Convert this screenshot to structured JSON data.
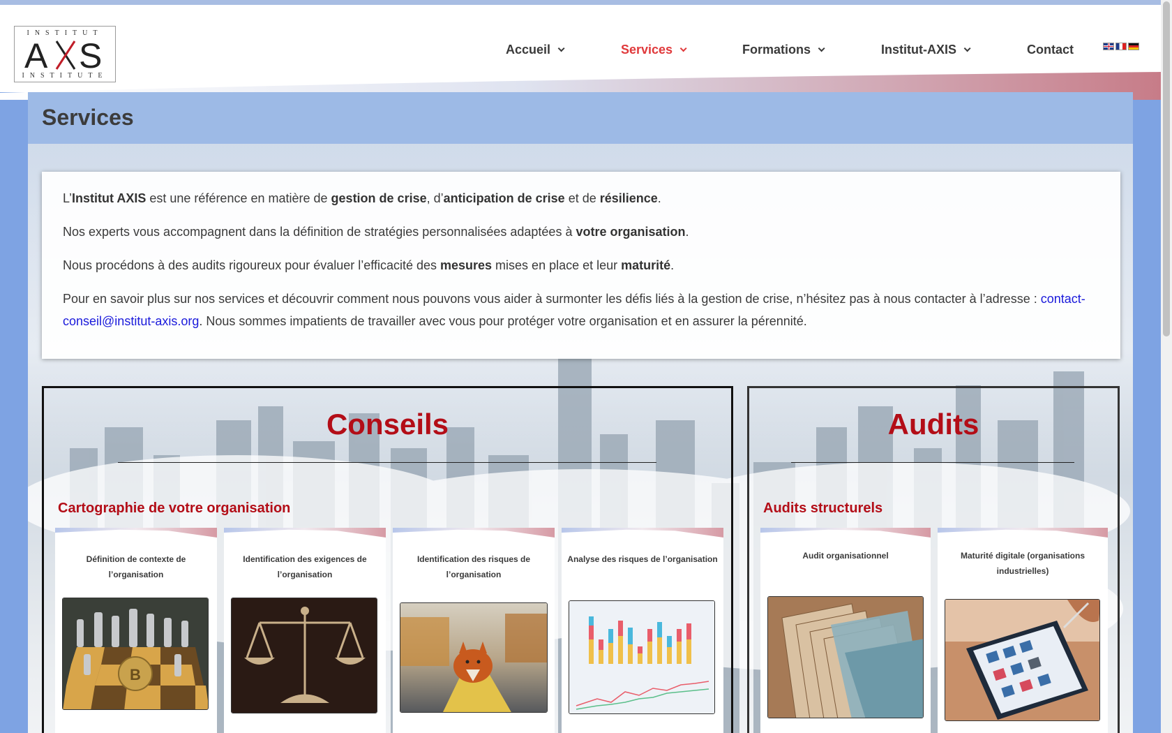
{
  "header": {
    "logo": {
      "top": "INSTITUT",
      "mid": "AXS",
      "bottom": "INSTITUTE"
    },
    "nav": [
      {
        "label": "Accueil",
        "has_dropdown": true,
        "active": false
      },
      {
        "label": "Services",
        "has_dropdown": true,
        "active": true
      },
      {
        "label": "Formations",
        "has_dropdown": true,
        "active": false
      },
      {
        "label": "Institut-AXIS",
        "has_dropdown": true,
        "active": false
      },
      {
        "label": "Contact",
        "has_dropdown": false,
        "active": false
      }
    ],
    "languages": [
      "en",
      "fr",
      "de"
    ],
    "active_color": "#e0393b"
  },
  "page": {
    "title": "Services"
  },
  "intro": {
    "p1": {
      "a": "L’",
      "b": "Institut AXIS",
      "c": " est une référence en matière de ",
      "d": "gestion de crise",
      "e": ", d’",
      "f": "anticipation de crise",
      "g": " et de ",
      "h": "résilience",
      "i": "."
    },
    "p2": {
      "a": "Nos experts vous accompagnent dans la définition de stratégies personnalisées adaptées à ",
      "b": "votre organisation",
      "c": "."
    },
    "p3": {
      "a": "Nous procédons à des audits rigoureux pour évaluer l’efficacité des ",
      "b": "mesures",
      "c": " mises en place et leur ",
      "d": "maturité",
      "e": "."
    },
    "p4": {
      "a": "Pour en savoir plus sur nos services et découvrir comment nous pouvons vous aider à surmonter les défis liés à la gestion de crise, n’hésitez pas à nous contacter à l’adresse : ",
      "link": "contact-conseil@institut-axis.org",
      "b": ". Nous sommes impatients de travailler avec vous pour protéger votre organisation et en assurer la pérennité."
    }
  },
  "conseils": {
    "title": "Conseils",
    "subtitle": "Cartographie de votre organisation",
    "cards": [
      {
        "title": "Définition de contexte de l’organisation",
        "image": "chess-bitcoin-image"
      },
      {
        "title": "Identification des exigences  de l’organisation",
        "image": "scales-image"
      },
      {
        "title": "Identification des risques  de l’organisation",
        "image": "fox-road-image"
      },
      {
        "title": "Analyse des risques  de l’organisation",
        "image": "bar-line-chart-image"
      }
    ]
  },
  "audits": {
    "title": "Audits",
    "subtitle": "Audits structurels",
    "cards": [
      {
        "title": "Audit organisationnel",
        "image": "file-folders-image"
      },
      {
        "title": "Maturité digitale (organisations industrielles)",
        "image": "tablet-image"
      }
    ]
  },
  "colors": {
    "accent_red": "#b30d17",
    "title_bar": "#9dbae6",
    "link": "#1a1adb"
  }
}
